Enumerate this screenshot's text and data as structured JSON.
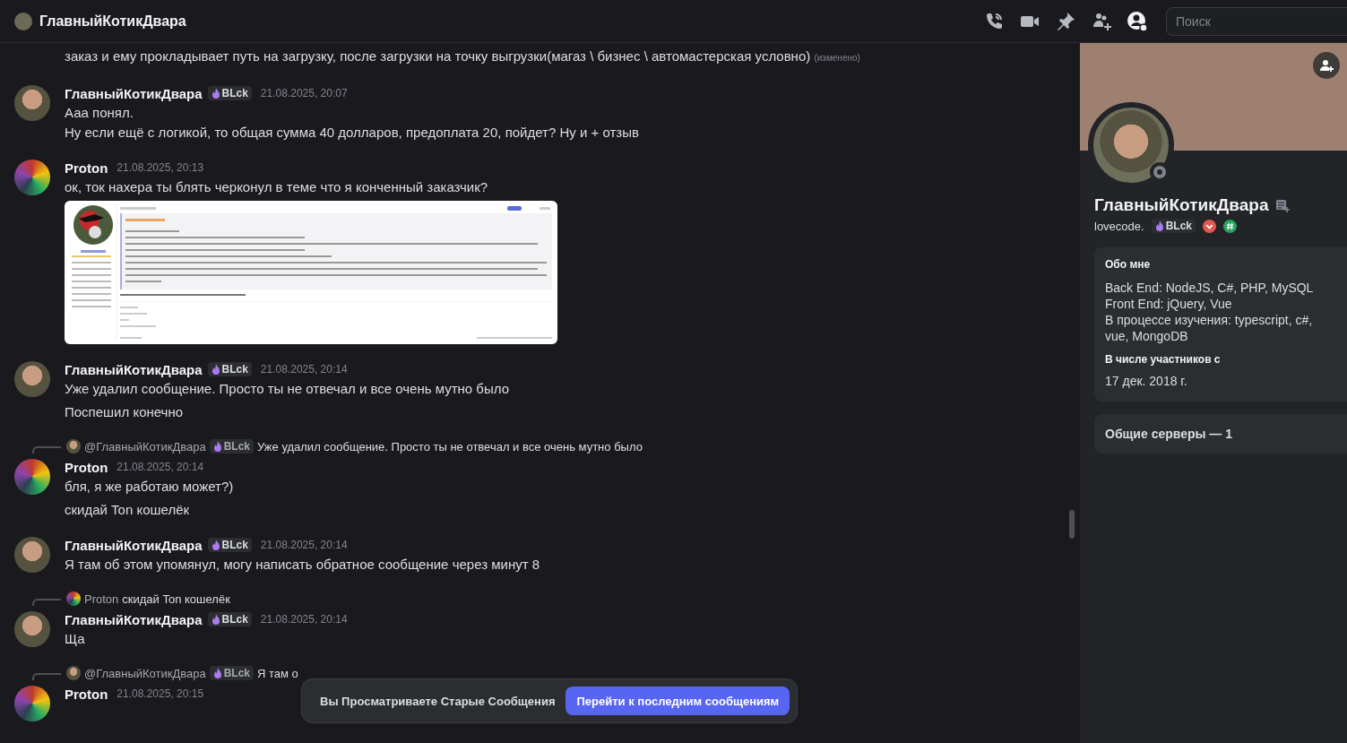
{
  "header": {
    "title": "ГлавныйКотикДвара",
    "search": {
      "placeholder": "Поиск"
    }
  },
  "messages": [
    {
      "kind": "continuation",
      "texts": [
        "заказ и ему прокладывает путь на загрузку, после загрузки на точку выгрузки(магаз \\ бизнес \\ автомастерская условно)"
      ],
      "edited": "(изменено)"
    },
    {
      "kind": "message",
      "author": "ГлавныйКотикДвара",
      "badge": "BLck",
      "timestamp": "21.08.2025, 20:07",
      "texts": [
        "Ааа понял.\nНу если ещё с логикой, то общая сумма 40 долларов, предоплата 20, пойдет? Ну и + отзыв"
      ]
    },
    {
      "kind": "message",
      "author": "Proton",
      "timestamp": "21.08.2025, 20:13",
      "texts": [
        "ок, ток нахера ты блять черконул в теме что я конченный заказчик?"
      ],
      "attachment": {
        "kind": "screenshot"
      }
    },
    {
      "kind": "message",
      "author": "ГлавныйКотикДвара",
      "badge": "BLck",
      "timestamp": "21.08.2025, 20:14",
      "texts": [
        "Уже удалил сообщение. Просто ты не отвечал и все очень мутно было",
        "Поспешил конечно"
      ]
    },
    {
      "kind": "message",
      "author": "Proton",
      "timestamp": "21.08.2025, 20:14",
      "reply": {
        "author": "@ГлавныйКотикДвара",
        "badge": "BLck",
        "text": "Уже удалил сообщение. Просто ты не отвечал и все очень мутно было"
      },
      "texts": [
        "бля, я же работаю может?)",
        "скидай Ton кошелёк"
      ]
    },
    {
      "kind": "message",
      "author": "ГлавныйКотикДвара",
      "badge": "BLck",
      "timestamp": "21.08.2025, 20:14",
      "texts": [
        "Я там об этом упомянул, могу написать обратное сообщение через минут 8"
      ]
    },
    {
      "kind": "message",
      "author": "ГлавныйКотикДвара",
      "badge": "BLck",
      "timestamp": "21.08.2025, 20:14",
      "reply": {
        "author": "Proton",
        "text": "скидай Ton кошелёк"
      },
      "texts": [
        "Ща"
      ]
    },
    {
      "kind": "message",
      "author": "Proton",
      "timestamp": "21.08.2025, 20:15",
      "reply": {
        "author": "@ГлавныйКотикДвара",
        "badge": "BLck",
        "text": "Я там о"
      }
    }
  ],
  "jump_bar": {
    "text": "Вы Просматриваете Старые Сообщения",
    "button": "Перейти к последним сообщениям"
  },
  "profile": {
    "name": "ГлавныйКотикДвара",
    "username": "lovecode.",
    "badge": "BLck",
    "about_title": "Обо мне",
    "about_lines": [
      "Back End: NodeJS, C#, PHP, MySQL",
      "Front End: jQuery, Vue",
      "В процессе изучения: typescript, c#, vue, MongoDB"
    ],
    "member_since_title": "В числе участников с",
    "member_since": "17 дек. 2018 г.",
    "mutual_servers": "Общие серверы — 1"
  }
}
